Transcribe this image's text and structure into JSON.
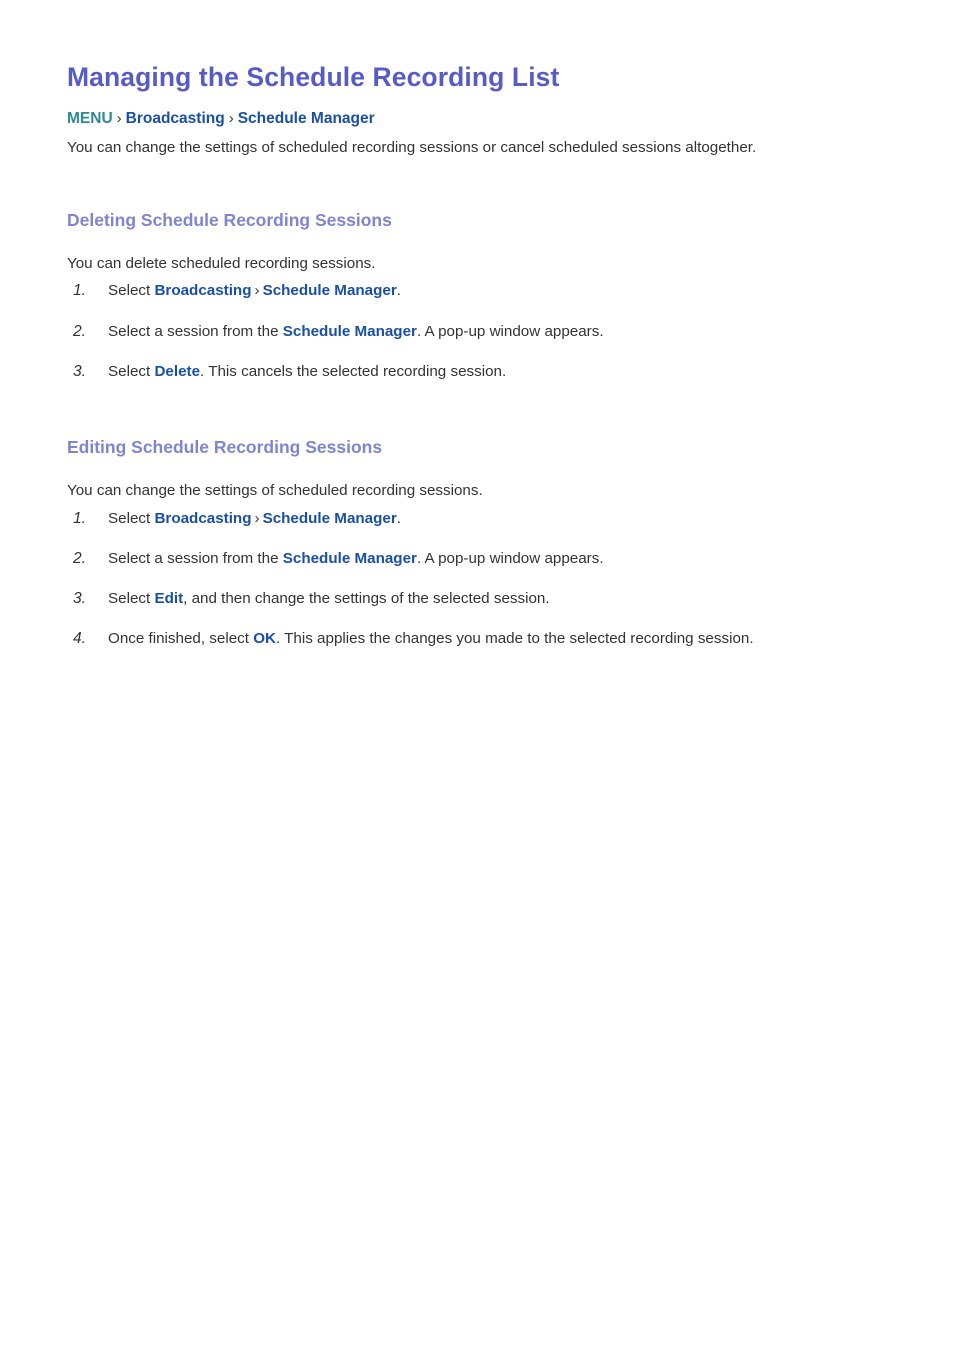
{
  "page": {
    "title": "Managing the Schedule Recording List",
    "intro": "You can change the settings of scheduled recording sessions or cancel scheduled sessions altogether."
  },
  "breadcrumb": {
    "menu_label": "MENU",
    "separator": "›",
    "items": [
      {
        "label": "Broadcasting"
      },
      {
        "label": "Schedule Manager"
      }
    ]
  },
  "colors": {
    "title": "#575cc4",
    "section_heading": "#8184d0",
    "link": "#1a4fa8",
    "menu": "#2d8a96",
    "body": "#333333",
    "background": "#ffffff"
  },
  "sections": [
    {
      "heading": "Deleting Schedule Recording Sessions",
      "intro": "You can delete scheduled recording sessions.",
      "steps": [
        {
          "number": "1.",
          "parts": [
            {
              "type": "text",
              "value": "Select "
            },
            {
              "type": "term",
              "value": "Broadcasting"
            },
            {
              "type": "sep",
              "value": "›"
            },
            {
              "type": "term",
              "value": "Schedule Manager"
            },
            {
              "type": "text",
              "value": "."
            }
          ]
        },
        {
          "number": "2.",
          "parts": [
            {
              "type": "text",
              "value": "Select a session from the "
            },
            {
              "type": "term",
              "value": "Schedule Manager"
            },
            {
              "type": "text",
              "value": ". A pop-up window appears."
            }
          ]
        },
        {
          "number": "3.",
          "parts": [
            {
              "type": "text",
              "value": "Select "
            },
            {
              "type": "term",
              "value": "Delete"
            },
            {
              "type": "text",
              "value": ". This cancels the selected recording session."
            }
          ]
        }
      ]
    },
    {
      "heading": "Editing Schedule Recording Sessions",
      "intro": "You can change the settings of scheduled recording sessions.",
      "steps": [
        {
          "number": "1.",
          "parts": [
            {
              "type": "text",
              "value": "Select "
            },
            {
              "type": "term",
              "value": "Broadcasting"
            },
            {
              "type": "sep",
              "value": "›"
            },
            {
              "type": "term",
              "value": "Schedule Manager"
            },
            {
              "type": "text",
              "value": "."
            }
          ]
        },
        {
          "number": "2.",
          "parts": [
            {
              "type": "text",
              "value": "Select a session from the "
            },
            {
              "type": "term",
              "value": "Schedule Manager"
            },
            {
              "type": "text",
              "value": ". A pop-up window appears."
            }
          ]
        },
        {
          "number": "3.",
          "parts": [
            {
              "type": "text",
              "value": "Select "
            },
            {
              "type": "term",
              "value": "Edit"
            },
            {
              "type": "text",
              "value": ", and then change the settings of the selected session."
            }
          ]
        },
        {
          "number": "4.",
          "parts": [
            {
              "type": "text",
              "value": "Once finished, select "
            },
            {
              "type": "term",
              "value": "OK"
            },
            {
              "type": "text",
              "value": ". This applies the changes you made to the selected recording session."
            }
          ]
        }
      ]
    }
  ]
}
